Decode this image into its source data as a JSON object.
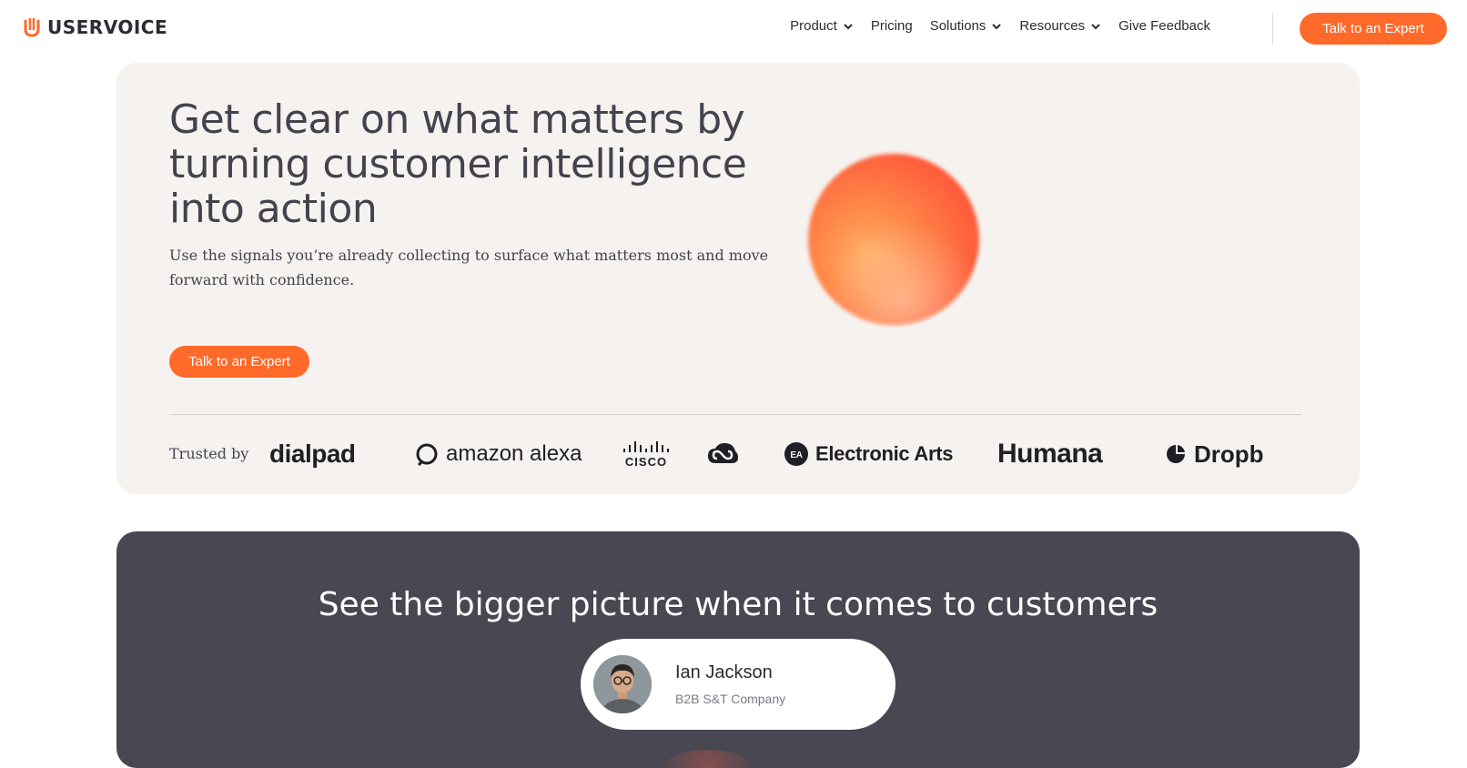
{
  "header": {
    "logo_text": "USERVOICE",
    "nav": [
      {
        "label": "Product",
        "has_dropdown": true
      },
      {
        "label": "Pricing",
        "has_dropdown": false
      },
      {
        "label": "Solutions",
        "has_dropdown": true
      },
      {
        "label": "Resources",
        "has_dropdown": true
      },
      {
        "label": "Give Feedback",
        "has_dropdown": false
      }
    ],
    "cta_label": "Talk to an Expert"
  },
  "hero": {
    "title": "Get clear on what matters by turning customer intelligence into action",
    "subtitle": "Use the signals you’re already collecting to surface what matters most and move forward with confidence.",
    "cta_label": "Talk to an Expert",
    "trusted_label": "Trusted by",
    "logos": {
      "dialpad": "dialpad",
      "alexa": "amazon alexa",
      "cisco": "CISCO",
      "ea": "Electronic Arts",
      "humana": "Humana",
      "dropbox": "Dropb"
    }
  },
  "section2": {
    "title": "See the bigger picture when it comes to customers",
    "person_name": "Ian Jackson",
    "person_org": "B2B S&T Company"
  },
  "colors": {
    "accent": "#ff6a2b",
    "hero_bg": "#f6f2ef",
    "dark_bg": "#484853",
    "text": "#43434f"
  }
}
